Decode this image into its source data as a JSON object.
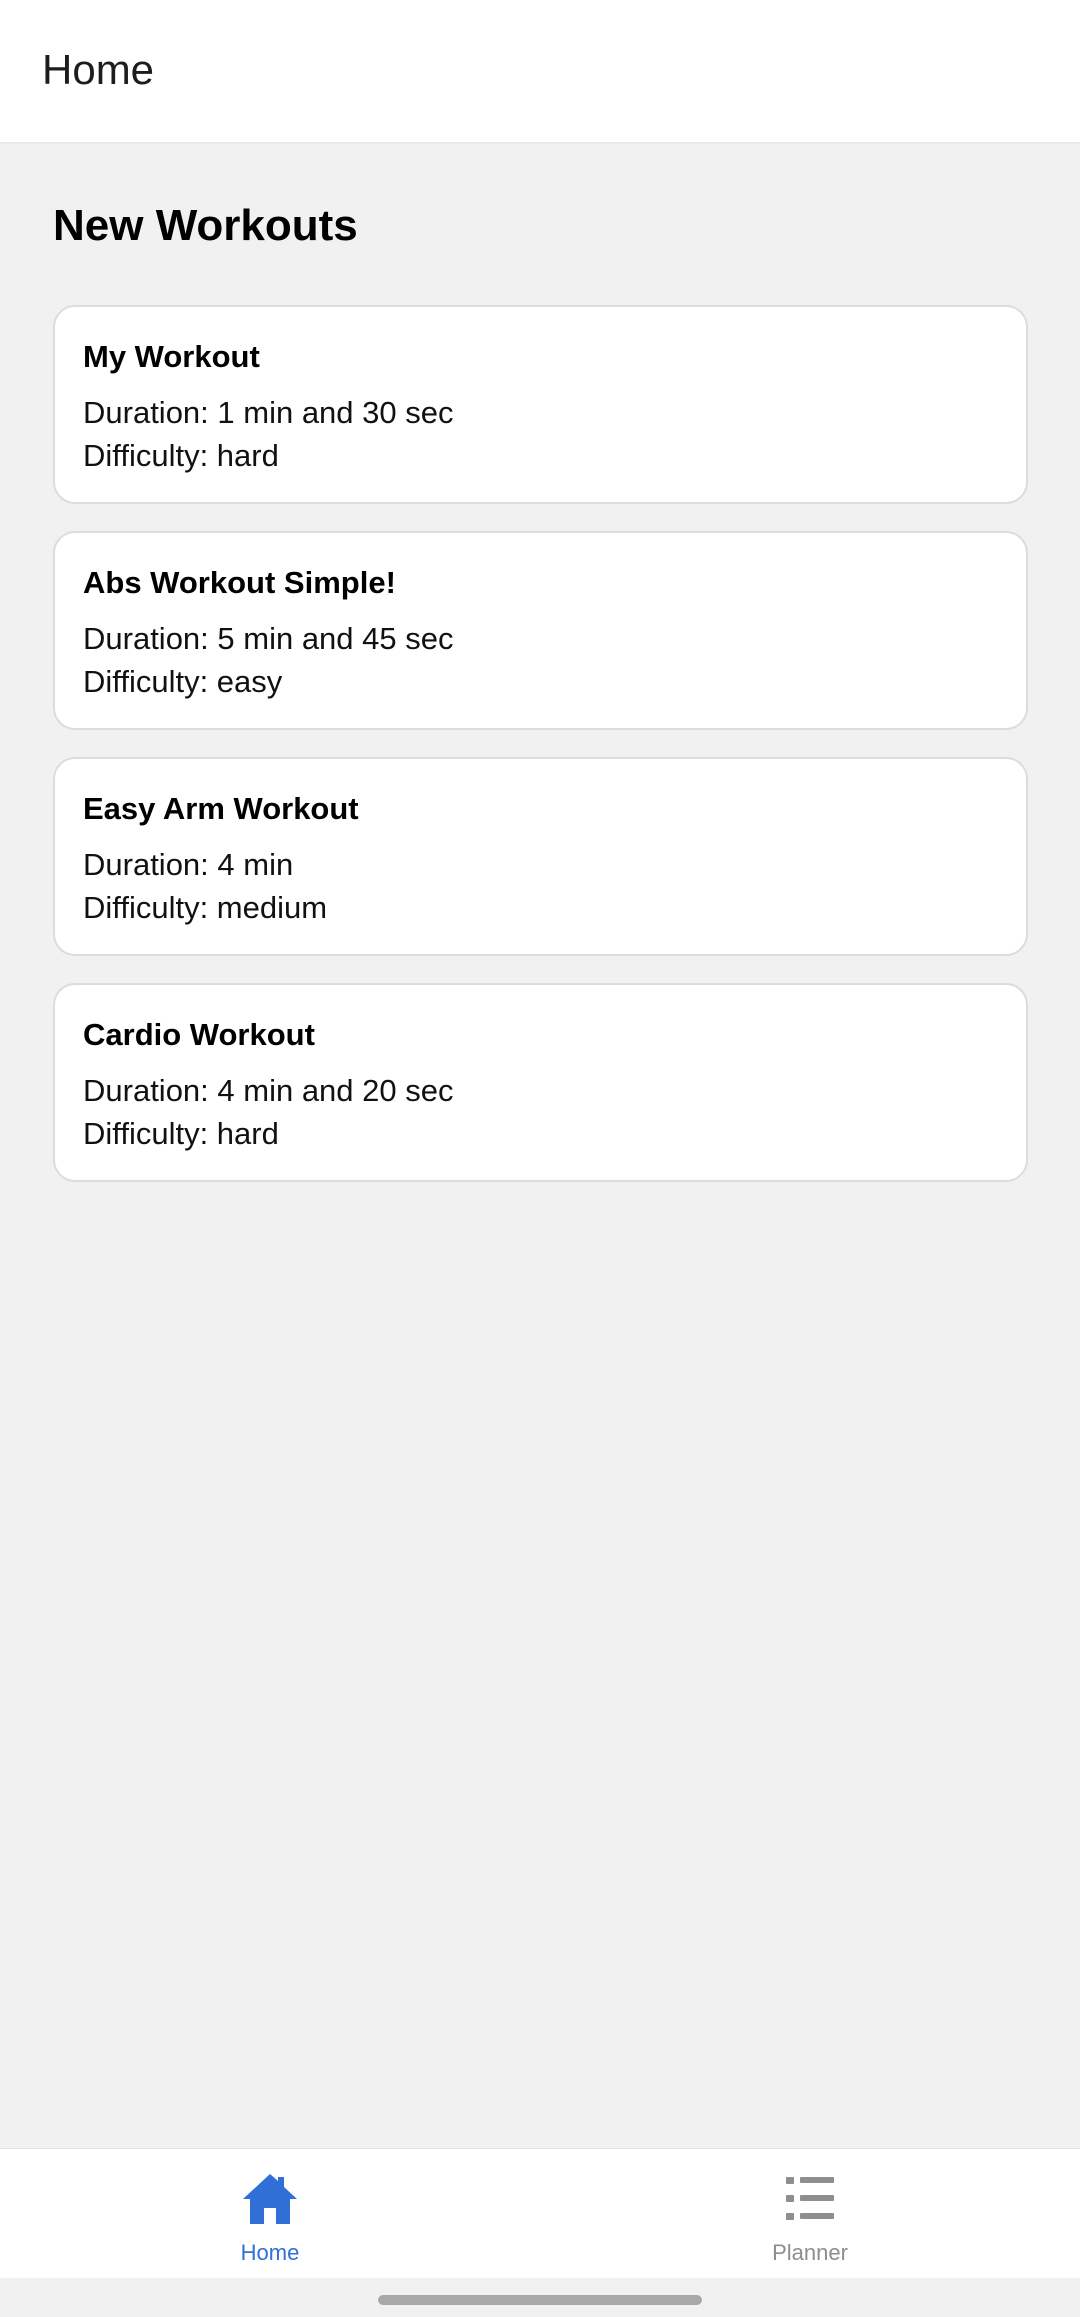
{
  "header": {
    "title": "Home"
  },
  "main": {
    "section_title": "New Workouts",
    "workouts": [
      {
        "name": "My Workout",
        "duration": "Duration: 1 min and 30 sec",
        "difficulty": "Difficulty: hard"
      },
      {
        "name": "Abs Workout Simple!",
        "duration": "Duration: 5 min and 45 sec",
        "difficulty": "Difficulty: easy"
      },
      {
        "name": "Easy Arm Workout",
        "duration": "Duration: 4 min",
        "difficulty": "Difficulty: medium"
      },
      {
        "name": "Cardio Workout",
        "duration": "Duration: 4 min and 20 sec",
        "difficulty": "Difficulty: hard"
      }
    ]
  },
  "bottom_nav": {
    "items": [
      {
        "label": "Home",
        "icon": "home-icon",
        "active": true
      },
      {
        "label": "Planner",
        "icon": "list-icon",
        "active": false
      }
    ]
  },
  "colors": {
    "accent": "#2f6fd6",
    "inactive": "#8e8e8e",
    "background": "#f1f1f1"
  }
}
